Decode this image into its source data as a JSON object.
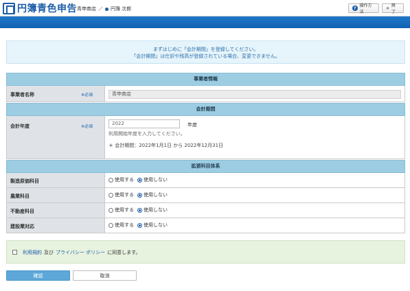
{
  "app": {
    "logo_text": "円簿青色申告",
    "breadcrumb": {
      "store": "青申商店",
      "separator": "／",
      "user": "円簿 次郎"
    },
    "help_icon_text": "?",
    "help_label": "操作方法",
    "exit_icon_text": "✕",
    "exit_label": "終了"
  },
  "notice": {
    "line1": "まずはじめに「会計期間」を登録してください。",
    "line2": "「会計期間」は仕訳や残高が登録されている場合、変更できません。"
  },
  "business": {
    "header": "事業者情報",
    "name_label": "事業者名称",
    "required": "※必須",
    "name_value": "青申商店"
  },
  "period_section": {
    "header": "会計期間",
    "year_label": "会計年度",
    "required": "※必須",
    "year_value": "2022",
    "year_suffix": "年度",
    "hint": "利用開始年度を入力してください。",
    "period_text": "＊ 会計期間：2022年1月1日 から 2022年12月31日"
  },
  "accounts": {
    "header": "拡張科目体系",
    "use_label": "使用する",
    "nouse_label": "使用しない",
    "rows": [
      {
        "label": "製造原価科目",
        "selected": "nouse"
      },
      {
        "label": "農業科目",
        "selected": "nouse"
      },
      {
        "label": "不動産科目",
        "selected": "nouse"
      },
      {
        "label": "建設業対応",
        "selected": "nouse"
      }
    ]
  },
  "agreement": {
    "terms_link": "利用規約",
    "and": "及び",
    "privacy_link": "プライバシー ポリシー",
    "suffix": "に同意します。",
    "checked": false
  },
  "buttons": {
    "confirm": "確認",
    "cancel": "取消"
  },
  "colors": {
    "brand": "#1c5da8",
    "section_header": "#9ccde2",
    "confirm_button": "#5da8d8",
    "agreement_bg": "#e7f2df"
  }
}
